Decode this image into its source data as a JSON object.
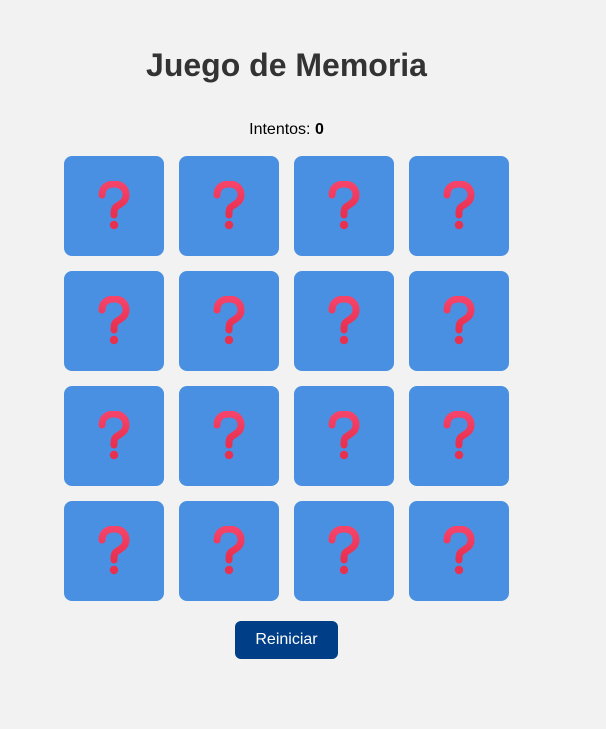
{
  "game": {
    "title": "Juego de Memoria",
    "attempts_label": "Intentos:",
    "attempts_value": "0",
    "reset_label": "Reiniciar",
    "card_back_icon": "question-mark-icon",
    "card_count": 16,
    "colors": {
      "background": "#f2f2f2",
      "card": "#4a90e2",
      "button": "#003f87",
      "question_mark": "#e8304f"
    }
  }
}
